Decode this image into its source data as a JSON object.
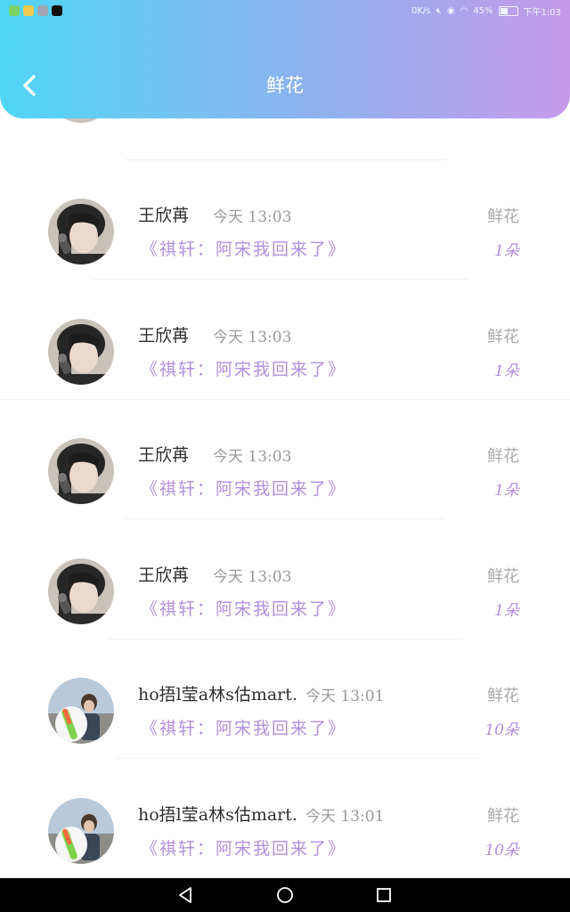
{
  "status_bar": {
    "speed": "0K/s",
    "battery": "45%",
    "battery_level": 0.45,
    "time": "下午1:03",
    "app_icons": [
      "app-icon-1",
      "app-icon-2",
      "app-icon-3",
      "tiktok-icon"
    ]
  },
  "header": {
    "title": "鲜花",
    "back_icon": "chevron-left-icon"
  },
  "records": [
    {
      "name": "王欣苒",
      "time": "今天 13:03",
      "message": "《祺轩：阿宋我回来了》",
      "gift": "鲜花",
      "count": "1朵",
      "avatar": "avatar-boy"
    },
    {
      "name": "王欣苒",
      "time": "今天 13:03",
      "message": "《祺轩：阿宋我回来了》",
      "gift": "鲜花",
      "count": "1朵",
      "avatar": "avatar-boy"
    },
    {
      "name": "王欣苒",
      "time": "今天 13:03",
      "message": "《祺轩：阿宋我回来了》",
      "gift": "鲜花",
      "count": "1朵",
      "avatar": "avatar-boy"
    },
    {
      "name": "王欣苒",
      "time": "今天 13:03",
      "message": "《祺轩：阿宋我回来了》",
      "gift": "鲜花",
      "count": "1朵",
      "avatar": "avatar-boy"
    },
    {
      "name": "ho捂l莹a林s估mart...",
      "time": "今天 13:01",
      "message": "《祺轩：阿宋我回来了》",
      "gift": "鲜花",
      "count": "10朵",
      "avatar": "avatar-girl"
    },
    {
      "name": "ho捂l莹a林s估mart...",
      "time": "今天 13:01",
      "message": "《祺轩：阿宋我回来了》",
      "gift": "鲜花",
      "count": "10朵",
      "avatar": "avatar-girl"
    }
  ],
  "nav_bar": {
    "back": "nav-back-icon",
    "home": "nav-home-icon",
    "recents": "nav-recents-icon"
  },
  "colors": {
    "header_start": "#4fd6f6",
    "header_end": "#c59ae9",
    "accent_purple": "#b28fdc"
  }
}
